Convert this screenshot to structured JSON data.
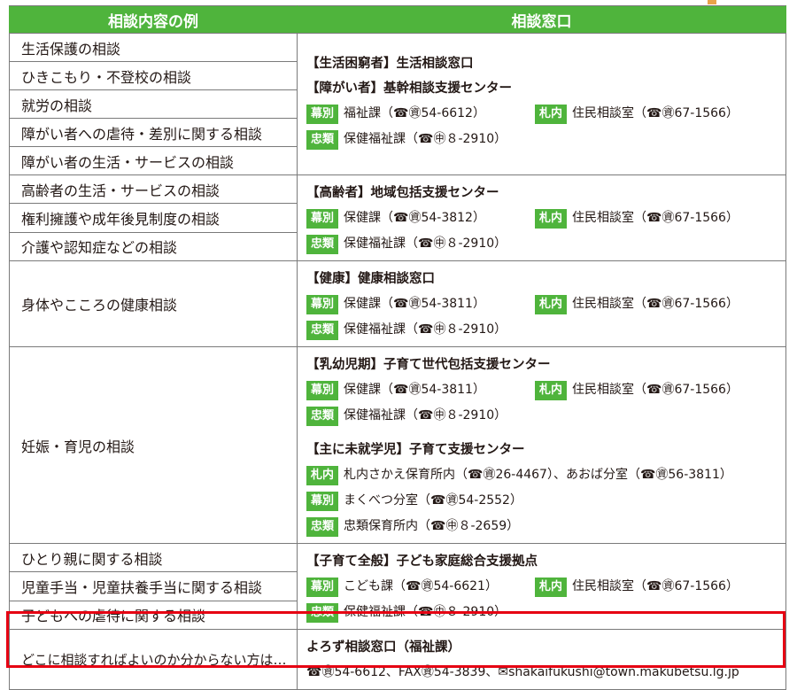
{
  "header": {
    "col1": "相談内容の例",
    "col2": "相談窓口"
  },
  "groups": [
    {
      "examples": [
        "生活保護の相談",
        "ひきこもり・不登校の相談",
        "就労の相談",
        "障がい者への虐待・差別に関する相談",
        "障がい者の生活・サービスの相談"
      ],
      "heads": [
        "【生活困窮者】生活相談窓口",
        "【障がい者】基幹相談支援センター"
      ],
      "lines": [
        {
          "left_badge": "幕別",
          "left_text": "福祉課（☎㊮54-6612）",
          "right_badge": "札内",
          "right_text": "住民相談室（☎㊮67-1566）"
        },
        {
          "left_badge": "忠類",
          "left_text": "保健福祉課（☎㊥８-2910）"
        }
      ]
    },
    {
      "examples": [
        "高齢者の生活・サービスの相談",
        "権利擁護や成年後見制度の相談",
        "介護や認知症などの相談"
      ],
      "heads": [
        "【高齢者】地域包括支援センター"
      ],
      "lines": [
        {
          "left_badge": "幕別",
          "left_text": "保健課（☎㊮54-3812）",
          "right_badge": "札内",
          "right_text": "住民相談室（☎㊮67-1566）"
        },
        {
          "left_badge": "忠類",
          "left_text": "保健福祉課（☎㊥８-2910）"
        }
      ]
    },
    {
      "examples": [
        "身体やこころの健康相談"
      ],
      "heads": [
        "【健康】健康相談窓口"
      ],
      "lines": [
        {
          "left_badge": "幕別",
          "left_text": "保健課（☎㊮54-3811）",
          "right_badge": "札内",
          "right_text": "住民相談室（☎㊮67-1566）"
        },
        {
          "left_badge": "忠類",
          "left_text": "保健福祉課（☎㊥８-2910）"
        }
      ]
    },
    {
      "examples": [
        "妊娠・育児の相談"
      ],
      "heads": [
        "【乳幼児期】子育て世代包括支援センター"
      ],
      "lines": [
        {
          "left_badge": "幕別",
          "left_text": "保健課（☎㊮54-3811）",
          "right_badge": "札内",
          "right_text": "住民相談室（☎㊮67-1566）"
        },
        {
          "left_badge": "忠類",
          "left_text": "保健福祉課（☎㊥８-2910）"
        }
      ],
      "heads2": [
        "【主に未就学児】子育て支援センター"
      ],
      "lines2": [
        {
          "left_badge": "札内",
          "left_text": "札内さかえ保育所内（☎㊮26-4467）、あおば分室（☎㊮56-3811）"
        },
        {
          "left_badge": "幕別",
          "left_text": "まくべつ分室（☎㊮54-2552）"
        },
        {
          "left_badge": "忠類",
          "left_text": "忠類保育所内（☎㊥８-2659）"
        }
      ]
    },
    {
      "examples": [
        "ひとり親に関する相談",
        "児童手当・児童扶養手当に関する相談",
        "子どもへの虐待に関する相談"
      ],
      "heads": [
        "【子育て全般】子ども家庭総合支援拠点"
      ],
      "lines": [
        {
          "left_badge": "幕別",
          "left_text": "こども課（☎㊮54-6621）",
          "right_badge": "札内",
          "right_text": "住民相談室（☎㊮67-1566）"
        },
        {
          "left_badge": "忠類",
          "left_text": "保健福祉課（☎㊥８-2910）"
        }
      ]
    }
  ],
  "last": {
    "example": "どこに相談すればよいのか分からない方は…",
    "head": "よろず相談窓口（福祉課）",
    "contact": "☎㊮54-6612、FAX㊮54-3839、✉shakaifukushi@town.makubetsu.lg.jp"
  },
  "colors": {
    "green": "#4fb43c",
    "highlight": "#e60012",
    "border": "#7a7a7a"
  }
}
